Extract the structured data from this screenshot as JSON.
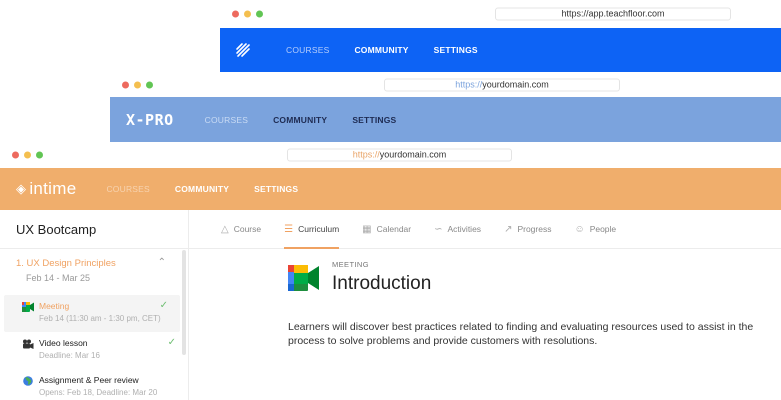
{
  "window_back": {
    "url_scheme": "https://",
    "url_host": "app.teachfloor.com",
    "nav": [
      "COURSES",
      "COMMUNITY",
      "SETTINGS"
    ],
    "colors": {
      "bar": "#0d63f5"
    }
  },
  "window_middle": {
    "url_scheme": "https://",
    "url_host": "yourdomain.com",
    "brand": "X-PRO",
    "nav": [
      "COURSES",
      "COMMUNITY",
      "SETTINGS"
    ],
    "colors": {
      "bar": "#7ba3dd"
    }
  },
  "window_front": {
    "url_scheme": "https://",
    "url_host": "yourdomain.com",
    "brand": "intime",
    "nav": [
      "COURSES",
      "COMMUNITY",
      "SETTINGS"
    ],
    "colors": {
      "bar": "#f0ae6c",
      "accent": "#f0a262"
    },
    "sidebar": {
      "course_title": "UX Bootcamp",
      "module": {
        "title": "1. UX Design Principles",
        "dates": "Feb 14 - Mar 25"
      },
      "lessons": [
        {
          "name": "Meeting",
          "sub": "Feb 14 (11:30 am - 1:30 pm, CET)",
          "icon": "google-meet-icon",
          "done": true
        },
        {
          "name": "Video lesson",
          "sub": "Deadline: Mar 16",
          "icon": "video-camera-icon",
          "done": true
        },
        {
          "name": "Assignment & Peer review",
          "sub": "Opens: Feb 18, Deadline: Mar 20",
          "icon": "globe-icon",
          "done": false
        }
      ]
    },
    "tabs": [
      {
        "label": "Course",
        "icon": "graduation-cap-icon"
      },
      {
        "label": "Curriculum",
        "icon": "list-icon",
        "active": true
      },
      {
        "label": "Calendar",
        "icon": "calendar-icon"
      },
      {
        "label": "Activities",
        "icon": "activity-chart-icon"
      },
      {
        "label": "Progress",
        "icon": "trend-line-icon"
      },
      {
        "label": "People",
        "icon": "people-icon"
      }
    ],
    "lesson": {
      "type": "MEETING",
      "title": "Introduction",
      "description_line1": "Learners will discover best practices related to finding and evaluating resources used to assist in the",
      "description_line2": "process to solve problems and provide customers with resolutions."
    }
  }
}
